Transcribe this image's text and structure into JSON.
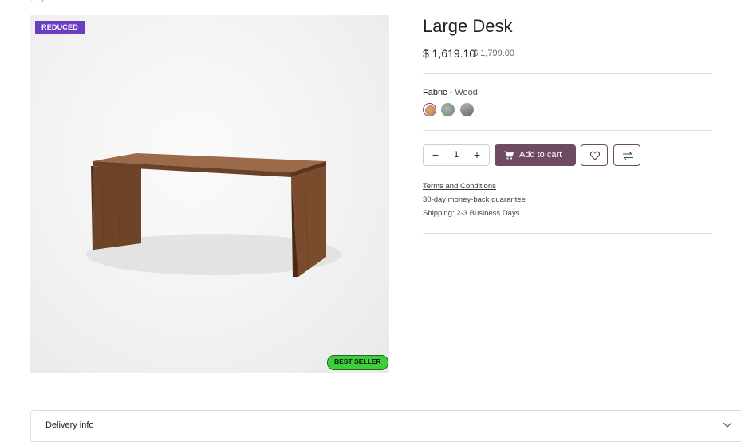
{
  "product": {
    "title": "Large Desk",
    "price": "$ 1,619.10",
    "old_price": "$ 1,799.00",
    "badges": {
      "reduced": "REDUCED",
      "best_seller": "BEST SELLER"
    }
  },
  "attribute": {
    "name": "Fabric",
    "separator": " - ",
    "value": "Wood",
    "swatches": [
      {
        "name": "wood",
        "color": "#c48a5e",
        "selected": true
      },
      {
        "name": "green-marble",
        "color": "#8a9a8c",
        "selected": false
      },
      {
        "name": "grey-stone",
        "color": "#8f8f8f",
        "selected": false
      }
    ]
  },
  "purchase": {
    "quantity": "1",
    "minus_symbol": "−",
    "plus_symbol": "+",
    "add_to_cart_label": "Add to cart",
    "cart_icon": "cart-icon",
    "wishlist_icon": "heart-icon",
    "compare_icon": "compare-icon"
  },
  "info": {
    "terms_link": "Terms and Conditions",
    "guarantee": "30-day money-back guarantee",
    "shipping": "Shipping: 2-3 Business Days"
  },
  "accordion": {
    "title": "Delivery info",
    "icon": "chevron-down-icon"
  },
  "colors": {
    "accent": "#6e4a63",
    "reduced_badge": "#6a3dc4",
    "bestseller_badge": "#3ccf3c"
  }
}
